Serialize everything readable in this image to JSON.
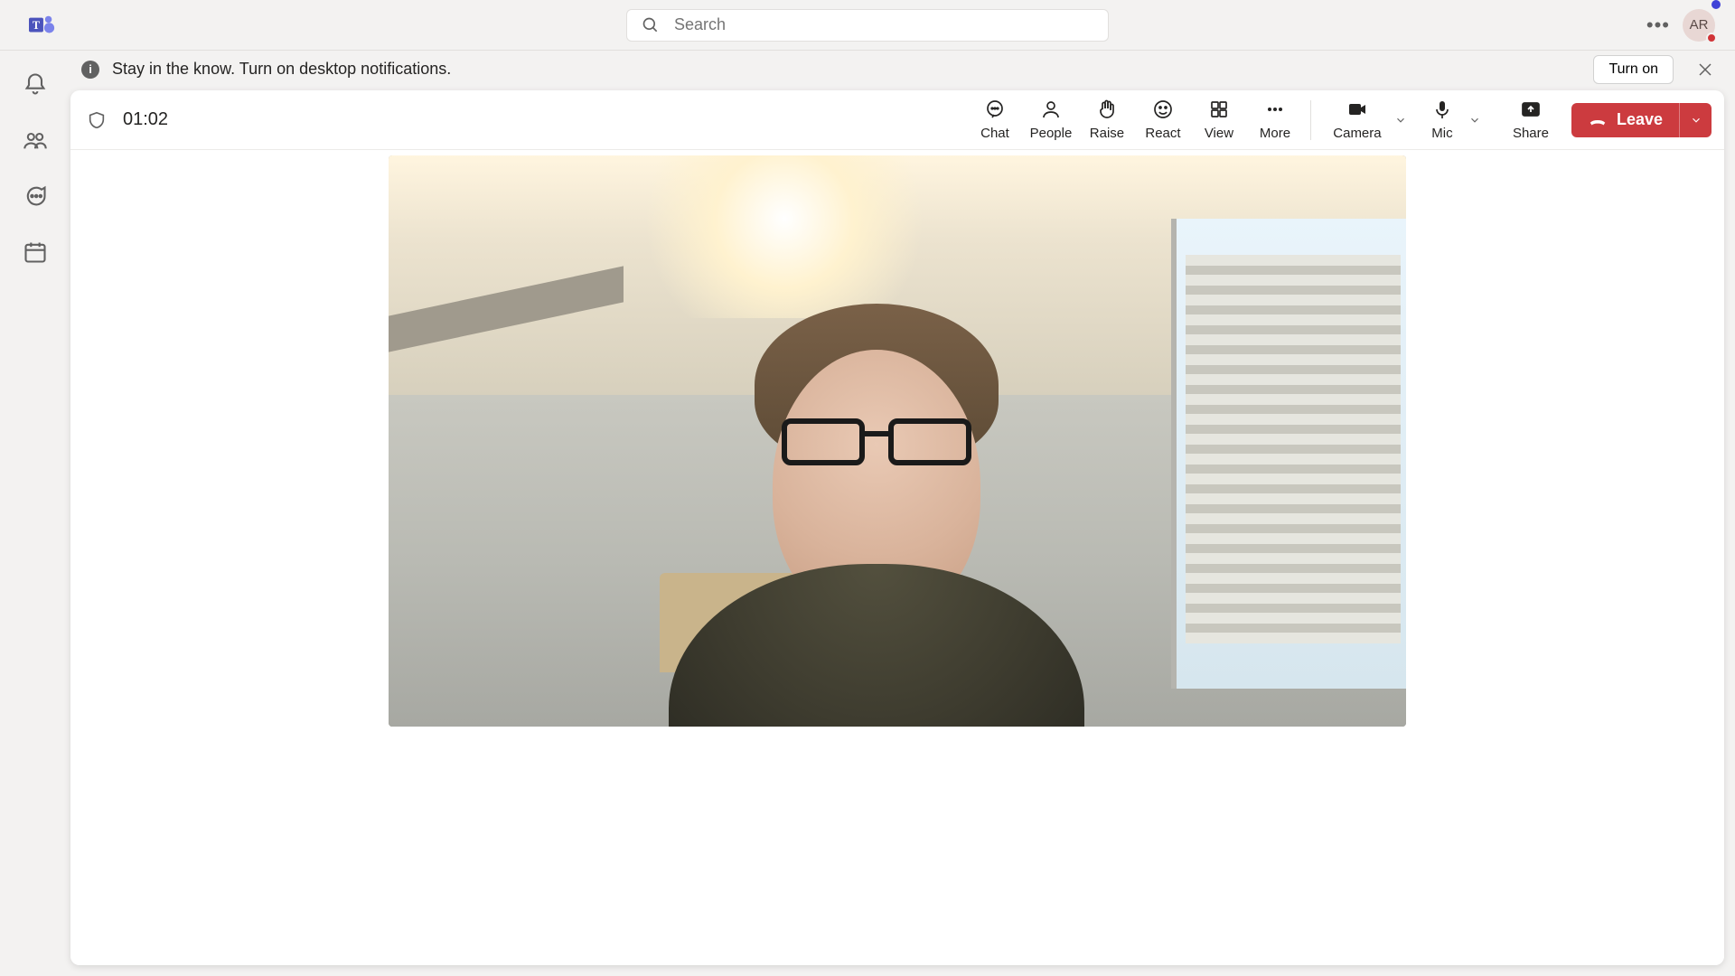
{
  "search": {
    "placeholder": "Search"
  },
  "avatar": {
    "initials": "AR"
  },
  "banner": {
    "text": "Stay in the know. Turn on desktop notifications.",
    "turn_on_label": "Turn on"
  },
  "meeting": {
    "timer": "01:02",
    "tools": {
      "chat": "Chat",
      "people": "People",
      "raise": "Raise",
      "react": "React",
      "view": "View",
      "more": "More",
      "camera": "Camera",
      "mic": "Mic",
      "share": "Share"
    },
    "leave_label": "Leave"
  },
  "icons": {
    "rail": [
      "activity",
      "community",
      "chat",
      "calendar"
    ]
  }
}
